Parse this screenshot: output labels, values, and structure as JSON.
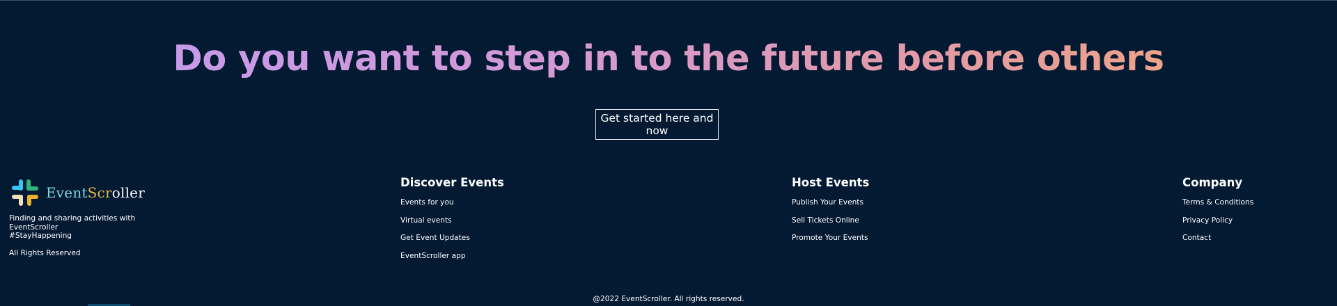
{
  "hero": {
    "headline": "Do you want to step in to the future before others",
    "cta_label": "Get started here and now",
    "gradient_colors": [
      "#c79ae8",
      "#eda289"
    ]
  },
  "brand": {
    "name_part1": "Event",
    "name_part2": "Scr",
    "name_part3": "oller",
    "logo_icon": "slack-style-logo-icon",
    "tagline_line1": "Finding and sharing activities with",
    "tagline_line2": "EventScroller",
    "tagline_line3": "#StayHappening",
    "rights": "All Rights Reserved"
  },
  "footer": {
    "discover": {
      "title": "Discover Events",
      "links": [
        "Events for you",
        "Virtual events",
        "Get Event Updates",
        "EventScroller app"
      ]
    },
    "host": {
      "title": "Host Events",
      "links": [
        "Publish Your Events",
        "Sell Tickets Online",
        "Promote Your Events"
      ]
    },
    "company": {
      "title": "Company",
      "links": [
        "Terms & Conditions",
        "Privacy Policy",
        "Contact"
      ]
    },
    "copyright": "@2022 EventScroller. All rights reserved."
  },
  "colors": {
    "background": "#041a33",
    "accent_teal": "#7fd3e0",
    "accent_gold": "#e0b64b"
  }
}
